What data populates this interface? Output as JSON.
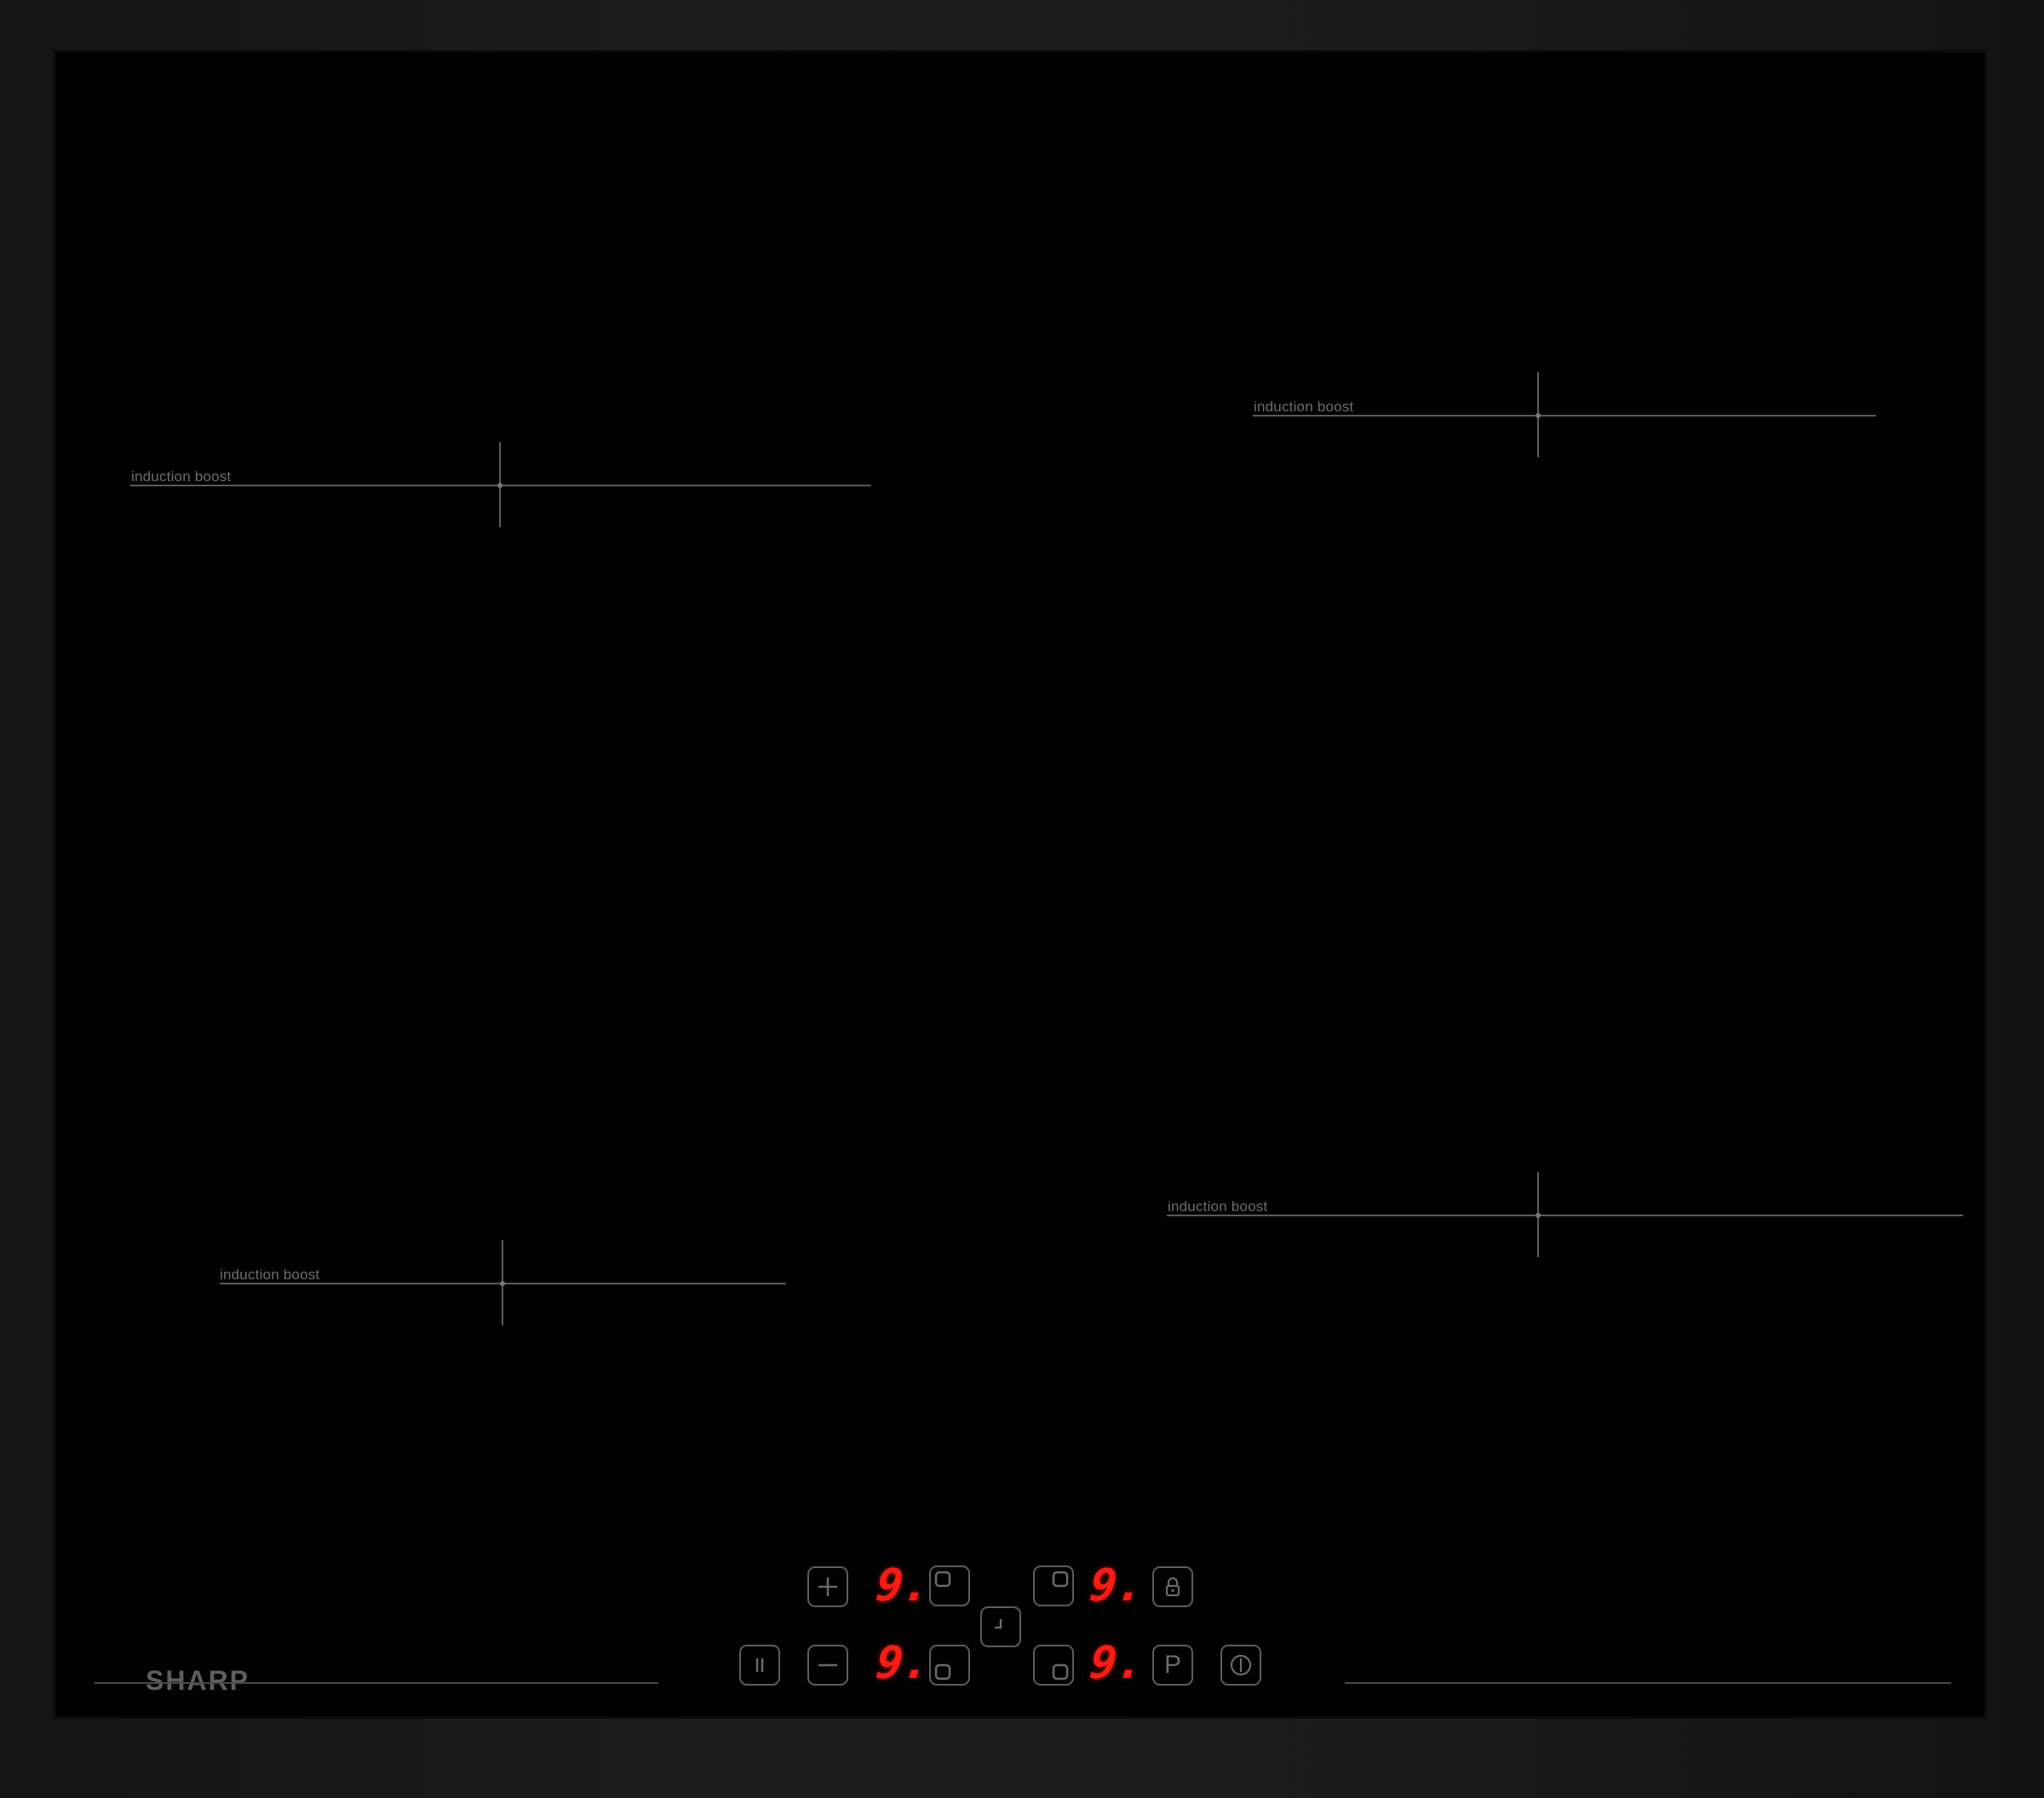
{
  "brand": {
    "name": "SHARP"
  },
  "zones": [
    {
      "id": "rear-left",
      "label": "induction boost"
    },
    {
      "id": "rear-right",
      "label": "induction boost"
    },
    {
      "id": "front-left",
      "label": "induction boost"
    },
    {
      "id": "front-right",
      "label": "induction boost"
    }
  ],
  "control_panel": {
    "displays": [
      {
        "id": "display-top-left",
        "value": "9."
      },
      {
        "id": "display-top-right",
        "value": "9."
      },
      {
        "id": "display-bottom-left",
        "value": "9."
      },
      {
        "id": "display-bottom-right",
        "value": "9."
      }
    ],
    "buttons": [
      {
        "id": "plus",
        "icon": "plus-icon"
      },
      {
        "id": "minus",
        "icon": "minus-icon"
      },
      {
        "id": "pause",
        "icon": "pause-icon"
      },
      {
        "id": "timer",
        "icon": "timer-icon"
      },
      {
        "id": "lock",
        "icon": "lock-icon"
      },
      {
        "id": "power-boost",
        "icon": "p-icon",
        "label": "P"
      },
      {
        "id": "power",
        "icon": "power-icon"
      },
      {
        "id": "zone-select-rear-left",
        "icon": "zone-rear-left-icon"
      },
      {
        "id": "zone-select-rear-right",
        "icon": "zone-rear-right-icon"
      },
      {
        "id": "zone-select-front-left",
        "icon": "zone-front-left-icon"
      },
      {
        "id": "zone-select-front-right",
        "icon": "zone-front-right-icon"
      }
    ]
  },
  "colors": {
    "glass": "#000000",
    "frame": "#1a1a1a",
    "display_led": "#ff1a12",
    "marking": "#5a5a5a"
  }
}
